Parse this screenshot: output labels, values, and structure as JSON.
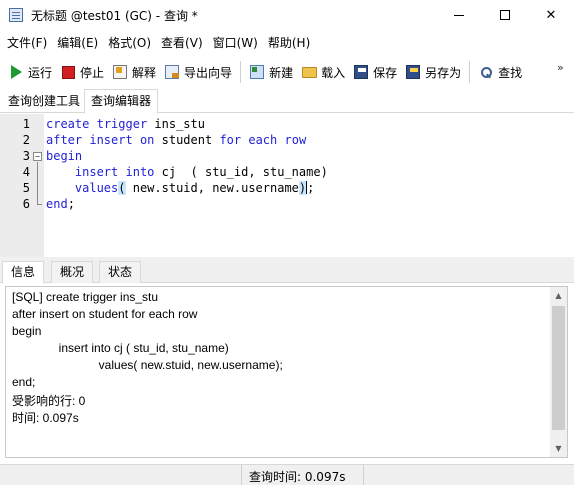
{
  "window": {
    "title": "无标题 @test01 (GC) - 查询 *",
    "minimize_label": "─",
    "maximize_label": "□",
    "close_label": "✕"
  },
  "menu": [
    "文件(F)",
    "编辑(E)",
    "格式(O)",
    "查看(V)",
    "窗口(W)",
    "帮助(H)"
  ],
  "toolbar": {
    "run": {
      "label": "运行",
      "icon": "run-icon"
    },
    "stop": {
      "label": "停止",
      "icon": "stop-icon"
    },
    "explain": {
      "label": "解释",
      "icon": "explain-icon"
    },
    "export_wizard": {
      "label": "导出向导",
      "icon": "export-icon"
    },
    "new": {
      "label": "新建",
      "icon": "new-icon"
    },
    "load": {
      "label": "载入",
      "icon": "folder-icon"
    },
    "save": {
      "label": "保存",
      "icon": "save-icon"
    },
    "save_as": {
      "label": "另存为",
      "icon": "save-as-icon"
    },
    "find": {
      "label": "查找",
      "icon": "search-icon"
    },
    "more": "»"
  },
  "tabs": [
    {
      "label": "查询创建工具",
      "active": false
    },
    {
      "label": "查询编辑器",
      "active": true
    }
  ],
  "editor": {
    "line_numbers": [
      "1",
      "2",
      "3",
      "4",
      "5",
      "6"
    ],
    "lines": [
      {
        "k1": "create",
        "t1": " ",
        "k2": "trigger",
        "t2": " ins_stu"
      },
      {
        "k1": "after",
        "t1": " ",
        "k2": "insert",
        "t2": " ",
        "k3": "on",
        "t3": " student ",
        "k4": "for",
        "t4": " ",
        "k5": "each",
        "t5": " ",
        "k6": "row"
      },
      {
        "k1": "begin"
      },
      {
        "indent": "    ",
        "k1": "insert",
        "t1": " ",
        "k2": "into",
        "t2": " cj  ( stu_id, stu_name)"
      },
      {
        "indent": "    ",
        "k1": "values",
        "open": "(",
        "t1": " new.stuid, new.username",
        "close": ")",
        "end": ";"
      },
      {
        "k1": "end",
        "t1": ";"
      }
    ],
    "fold_marker": "−"
  },
  "bottom_tabs": [
    {
      "label": "信息",
      "active": true
    },
    {
      "label": "概况",
      "active": false
    },
    {
      "label": "状态",
      "active": false
    }
  ],
  "info_lines": [
    "[SQL] create trigger ins_stu",
    "after insert on student for each row",
    "begin",
    "              insert into cj ( stu_id, stu_name)",
    "                          values( new.stuid, new.username);",
    "end;",
    "受影响的行: 0",
    "时间: 0.097s"
  ],
  "scroll_arrows": {
    "up": "▲",
    "down": "▼"
  },
  "status": {
    "query_time": "查询时间: 0.097s"
  }
}
